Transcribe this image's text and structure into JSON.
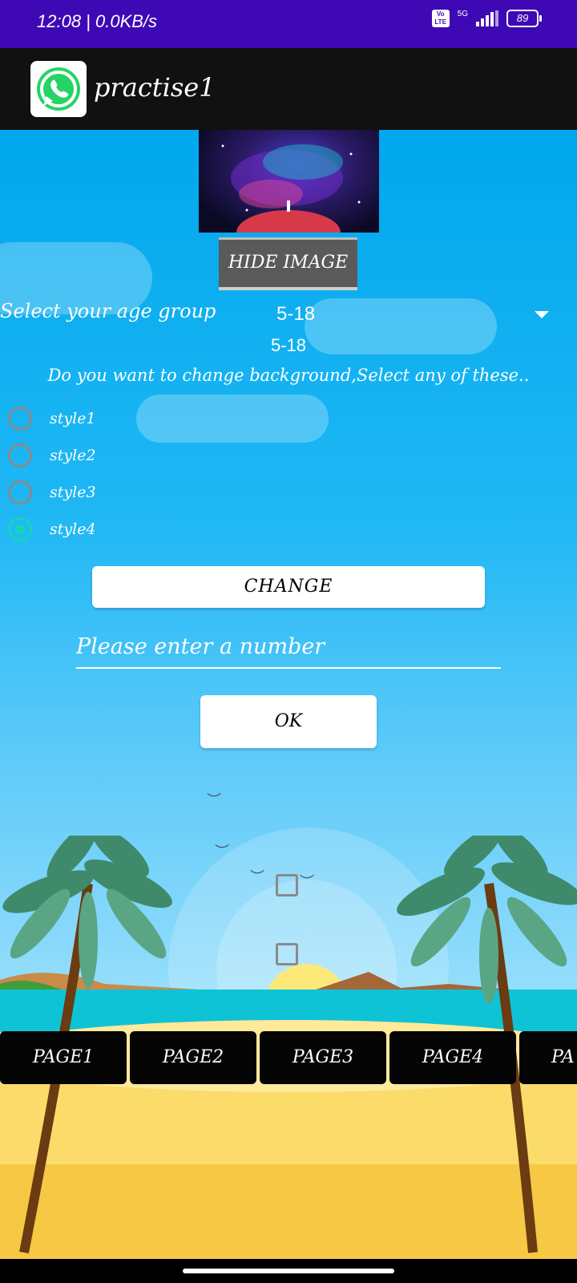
{
  "status_bar": {
    "time": "12:08 | 0.0KB/s",
    "volte": "Vo LTE",
    "network": "5G",
    "battery": "89"
  },
  "app_bar": {
    "title": "practise1",
    "logo_icon": "whatsapp-logo-icon"
  },
  "main": {
    "hide_image_label": "HIDE IMAGE",
    "age_group_label": "Select your age group",
    "age_group_selected": "5-18",
    "age_group_echo": "5-18",
    "background_question": "Do you want to change background,Select any of these..",
    "radio_options": [
      {
        "label": "style1",
        "checked": false
      },
      {
        "label": "style2",
        "checked": false
      },
      {
        "label": "style3",
        "checked": false
      },
      {
        "label": "style4",
        "checked": true
      }
    ],
    "change_button": "CHANGE",
    "number_placeholder": "Please enter a number",
    "ok_button": "OK",
    "accent_color": "#14d6b6"
  },
  "tabs": [
    "PAGE1",
    "PAGE2",
    "PAGE3",
    "PAGE4",
    "PA"
  ]
}
